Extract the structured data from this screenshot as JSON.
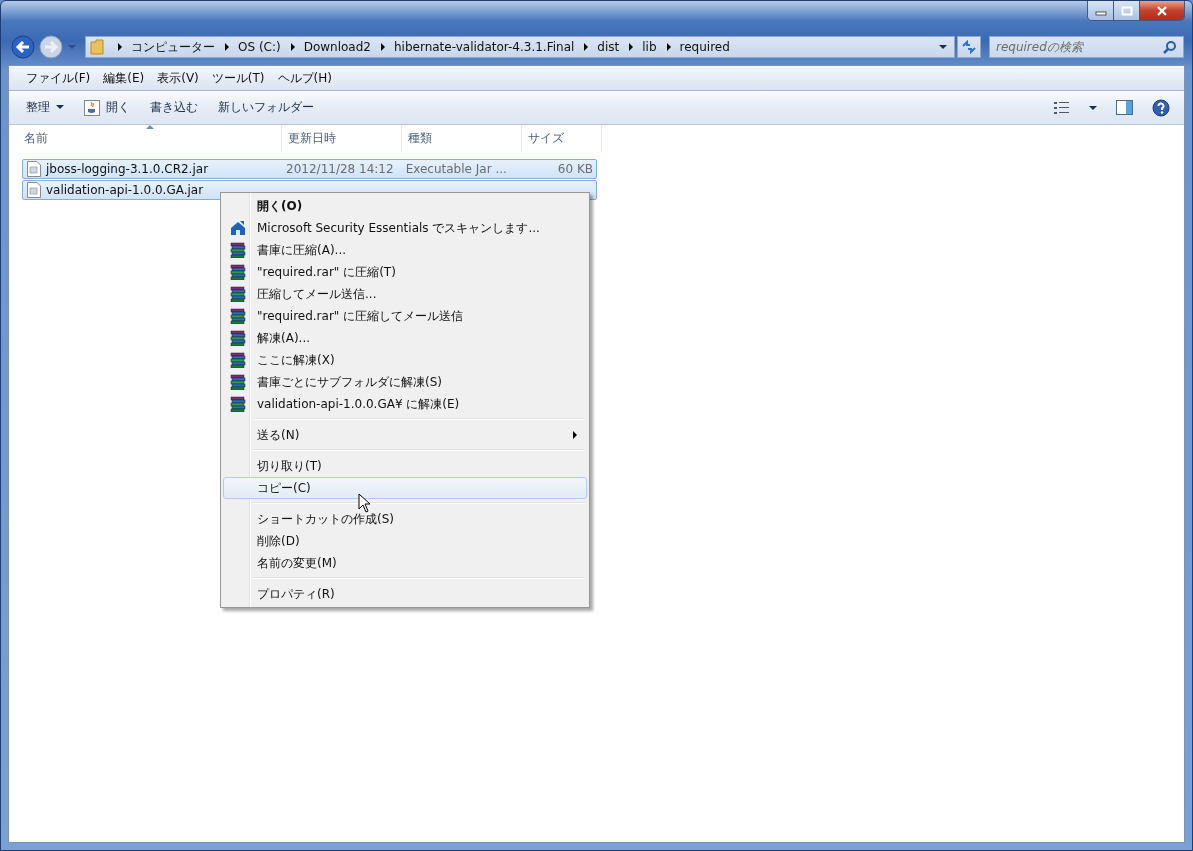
{
  "address_bar": {
    "breadcrumbs": [
      "コンピューター",
      "OS (C:)",
      "Download2",
      "hibernate-validator-4.3.1.Final",
      "dist",
      "lib",
      "required"
    ]
  },
  "search": {
    "placeholder": "requiredの検索"
  },
  "menu_bar": [
    "ファイル(F)",
    "編集(E)",
    "表示(V)",
    "ツール(T)",
    "ヘルプ(H)"
  ],
  "toolbar": [
    {
      "label": "整理",
      "kind": "dropdown"
    },
    {
      "label": "開く",
      "kind": "icon"
    },
    {
      "label": "書き込む",
      "kind": "plain"
    },
    {
      "label": "新しいフォルダー",
      "kind": "plain"
    }
  ],
  "file_list": {
    "columns": [
      {
        "label": "名前",
        "sorted": true
      },
      {
        "label": "更新日時",
        "sorted": false
      },
      {
        "label": "種類",
        "sorted": false
      },
      {
        "label": "サイズ",
        "sorted": false
      }
    ],
    "rows": [
      {
        "name": "jboss-logging-3.1.0.CR2.jar",
        "modified": "2012/11/28 14:12",
        "type": "Executable Jar ...",
        "size": "60 KB",
        "selected": true
      },
      {
        "name": "validation-api-1.0.0.GA.jar",
        "selected": true
      }
    ]
  },
  "context_menu": [
    {
      "kind": "default",
      "label": "開く(O)",
      "selected": false
    },
    {
      "kind": "scan",
      "label": "Microsoft Security Essentials でスキャンします...",
      "selected": false
    },
    {
      "kind": "archive",
      "label": "書庫に圧縮(A)...",
      "selected": false
    },
    {
      "kind": "archive",
      "label": "\"required.rar\" に圧縮(T)",
      "selected": false
    },
    {
      "kind": "archive",
      "label": "圧縮してメール送信...",
      "selected": false
    },
    {
      "kind": "archive",
      "label": "\"required.rar\" に圧縮してメール送信",
      "selected": false
    },
    {
      "kind": "archive",
      "label": "解凍(A)...",
      "selected": false
    },
    {
      "kind": "archive",
      "label": "ここに解凍(X)",
      "selected": false
    },
    {
      "kind": "archive",
      "label": "書庫ごとにサブフォルダに解凍(S)",
      "selected": false
    },
    {
      "kind": "archive",
      "label": "validation-api-1.0.0.GA¥ に解凍(E)",
      "selected": false
    },
    {
      "kind": "separator"
    },
    {
      "kind": "submenu",
      "label": "送る(N)",
      "selected": false
    },
    {
      "kind": "separator"
    },
    {
      "kind": "item",
      "label": "切り取り(T)",
      "selected": false
    },
    {
      "kind": "item",
      "label": "コピー(C)",
      "selected": true
    },
    {
      "kind": "separator"
    },
    {
      "kind": "item",
      "label": "ショートカットの作成(S)",
      "selected": false
    },
    {
      "kind": "item",
      "label": "削除(D)",
      "selected": false
    },
    {
      "kind": "item",
      "label": "名前の変更(M)",
      "selected": false
    },
    {
      "kind": "separator"
    },
    {
      "kind": "item",
      "label": "プロパティ(R)",
      "selected": false
    }
  ]
}
